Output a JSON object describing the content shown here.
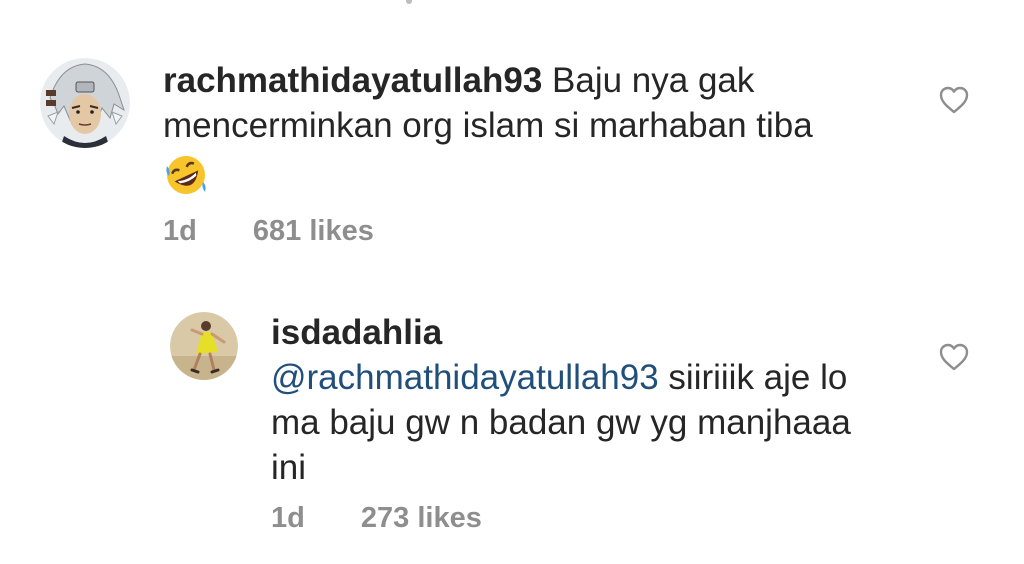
{
  "comments": [
    {
      "username": "rachmathidayatullah93",
      "text_line1": " Baju nya gak",
      "text_line2": "mencerminkan org islam si marhaban tiba",
      "emoji": "rolling-on-floor-laughing-emoji",
      "time": "1d",
      "likes": "681 likes",
      "avatar": "anime-character-avatar",
      "like_icon": "heart-outline-icon"
    }
  ],
  "reply": {
    "username": "isdadahlia",
    "mention": "@rachmathidayatullah93",
    "text_line1": " siiriiik aje lo",
    "text_line2": "ma baju gw n badan gw yg manjhaaa",
    "text_line3": "ini",
    "time": "1d",
    "likes": "273 likes",
    "avatar": "woman-yellow-dress-avatar",
    "like_icon": "heart-outline-icon"
  },
  "colors": {
    "text": "#262626",
    "meta": "#8e8e8e",
    "mention": "#1f4f7a",
    "heart_stroke": "#8e8e8e"
  }
}
